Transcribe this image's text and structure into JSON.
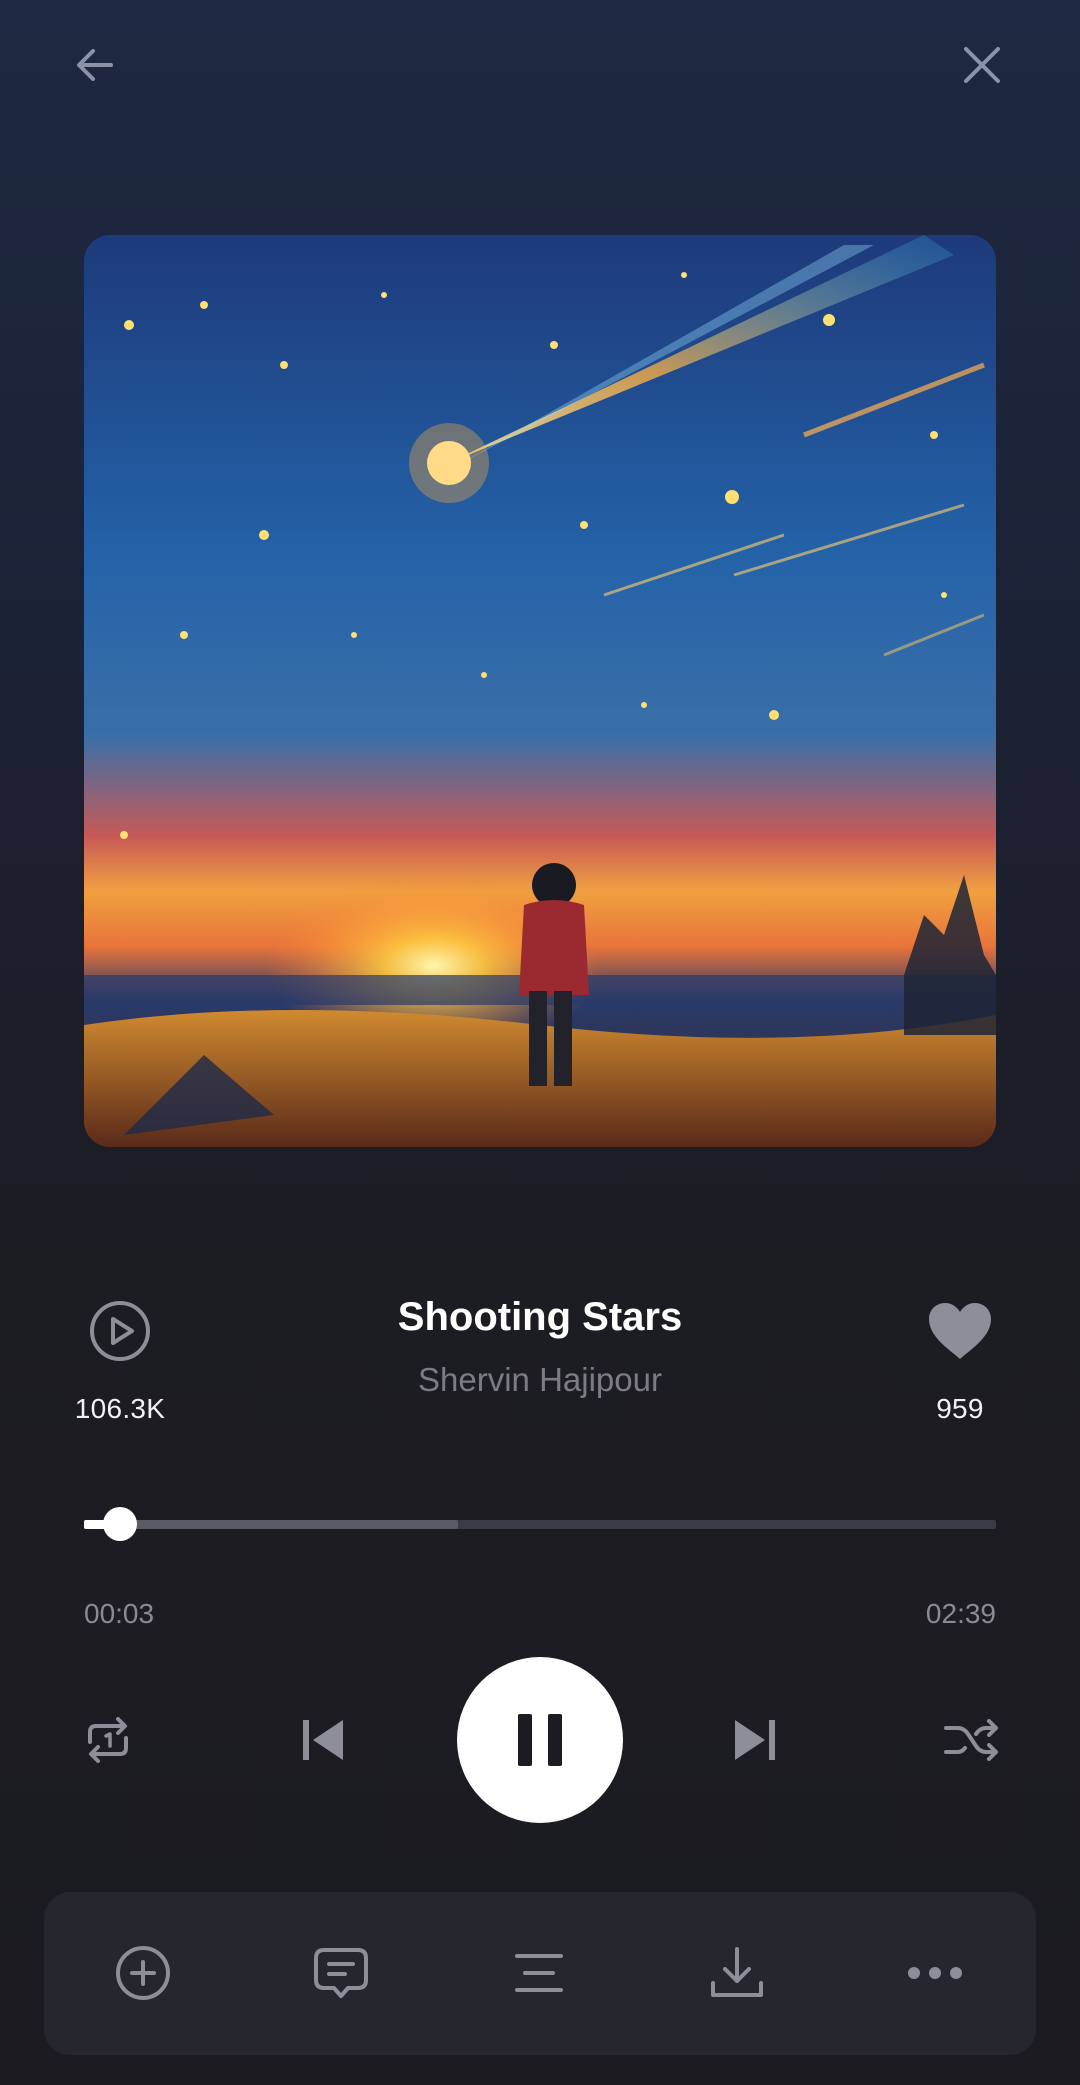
{
  "header": {
    "back_icon": "arrow-left-icon",
    "close_icon": "close-icon"
  },
  "track": {
    "title": "Shooting Stars",
    "artist": "Shervin Hajipour",
    "play_count": "106.3K",
    "like_count": "959"
  },
  "playback": {
    "elapsed": "00:03",
    "total": "02:39",
    "progress_fraction": 0.019,
    "buffered_fraction": 0.41,
    "state": "playing"
  },
  "controls": [
    "repeat-icon",
    "skip-previous-icon",
    "pause-icon",
    "skip-next-icon",
    "shuffle-icon"
  ],
  "actions": [
    "add-circle-icon",
    "comment-icon",
    "lyrics-icon",
    "download-icon",
    "more-icon"
  ],
  "colors": {
    "background_top": "#1d2942",
    "background_bottom": "#1b1b21",
    "artist_text": "#7c7c85",
    "icon_gray": "#8e8e99",
    "action_bar": "#26262f"
  }
}
